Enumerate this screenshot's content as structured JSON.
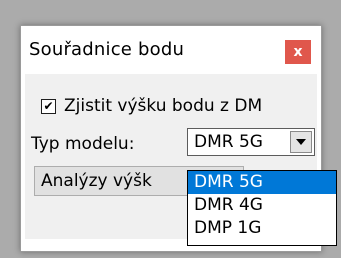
{
  "window": {
    "title": "Souřadnice bodu",
    "close_label": "x"
  },
  "elevation_checkbox": {
    "label": "Zjistit výšku bodu z DM",
    "checked": true
  },
  "model_type": {
    "label": "Typ modelu:",
    "selected": "DMR 5G",
    "options": [
      "DMR 5G",
      "DMR 4G",
      "DMP 1G"
    ]
  },
  "analysis_button": {
    "label": "Analýzy výšk"
  },
  "colors": {
    "close_button": "#e0574c",
    "selection_highlight": "#0078d7"
  }
}
